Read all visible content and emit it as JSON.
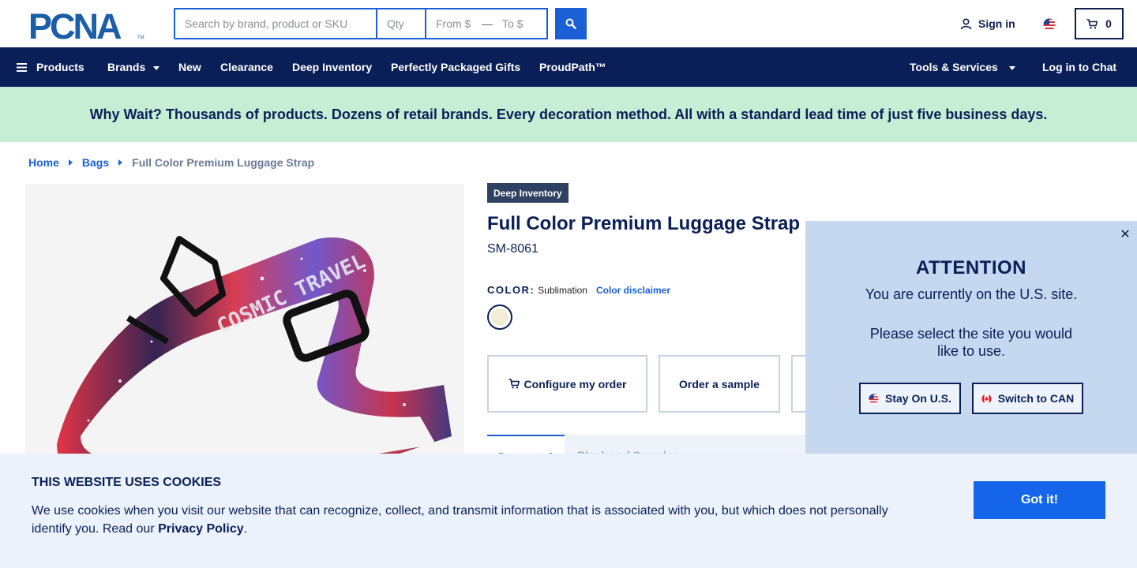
{
  "brand": {
    "logo_text": "PCNA"
  },
  "search": {
    "placeholder": "Search by brand, product or SKU",
    "qty_placeholder": "Qty",
    "from_placeholder": "From $",
    "range_dash": "—",
    "to_placeholder": "To $"
  },
  "header": {
    "signin_label": "Sign in",
    "cart_count": "0"
  },
  "nav": {
    "products": "Products",
    "brands": "Brands",
    "new": "New",
    "clearance": "Clearance",
    "deep_inventory": "Deep Inventory",
    "gifts": "Perfectly Packaged Gifts",
    "proudpath": "ProudPath™",
    "tools": "Tools & Services",
    "chat": "Log in to Chat"
  },
  "promo": {
    "text": "Why Wait? Thousands of products. Dozens of retail brands. Every decoration method. All with a standard lead time of just five business days."
  },
  "breadcrumb": {
    "home": "Home",
    "bags": "Bags",
    "current": "Full Color Premium Luggage Strap"
  },
  "product": {
    "badge": "Deep Inventory",
    "title": "Full Color Premium Luggage Strap",
    "sku": "SM-8061",
    "color_label": "COLOR:",
    "color_value": "Sublimation",
    "color_disclaimer": "Color disclaimer",
    "image_text": "COSMIC TRAVEL",
    "actions": {
      "configure": "Configure my order",
      "sample": "Order a sample"
    },
    "tabs": {
      "first": "Decorated",
      "second": "Blank and Samples"
    }
  },
  "attention": {
    "title": "ATTENTION",
    "subtitle": "You are currently on the U.S. site.",
    "question": "Please select the site you would like to use.",
    "stay_label": "Stay On U.S.",
    "switch_label": "Switch to CAN",
    "close_symbol": "✕"
  },
  "cookie": {
    "title": "THIS WEBSITE USES COOKIES",
    "body": "We use cookies when you visit our website that can recognize, collect, and transmit information that is associated with you, but which does not personally identify you. Read our ",
    "policy_link": "Privacy Policy",
    "suffix": ".",
    "button": "Got it!"
  },
  "colors": {
    "navy": "#0a1f57",
    "accent_blue": "#1a5fd6",
    "promo_green": "#c6eed5",
    "attention_bg": "#c5d8f0",
    "cookie_bg": "#ebf2fc"
  }
}
